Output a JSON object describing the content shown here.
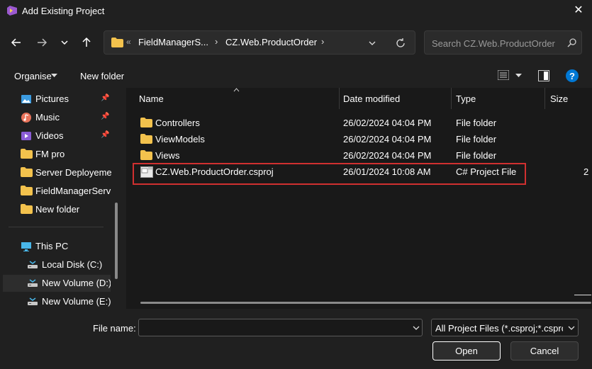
{
  "window": {
    "title": "Add Existing Project"
  },
  "address": {
    "overflow": "«",
    "crumb1": "FieldManagerS...",
    "crumb2": "CZ.Web.ProductOrder"
  },
  "search": {
    "placeholder": "Search CZ.Web.ProductOrder"
  },
  "toolbar": {
    "organise": "Organise",
    "new_folder": "New folder"
  },
  "nav": {
    "quick_access": [
      {
        "label": "Pictures",
        "icon": "pictures-icon",
        "pinned": true
      },
      {
        "label": "Music",
        "icon": "music-icon",
        "pinned": true
      },
      {
        "label": "Videos",
        "icon": "videos-icon",
        "pinned": true
      },
      {
        "label": "FM pro",
        "icon": "folder-icon",
        "pinned": false
      },
      {
        "label": "Server Deployeme",
        "icon": "folder-icon",
        "pinned": false
      },
      {
        "label": "FieldManagerServ",
        "icon": "folder-icon",
        "pinned": false
      },
      {
        "label": "New folder",
        "icon": "folder-icon",
        "pinned": false
      }
    ],
    "this_pc": "This PC",
    "drives": [
      "Local Disk (C:)",
      "New Volume (D:)",
      "New Volume (E:)"
    ]
  },
  "columns": {
    "name": "Name",
    "date": "Date modified",
    "type": "Type",
    "size": "Size"
  },
  "files": [
    {
      "name": "Controllers",
      "date": "26/02/2024 04:04 PM",
      "type": "File folder",
      "size": "",
      "kind": "folder"
    },
    {
      "name": "ViewModels",
      "date": "26/02/2024 04:04 PM",
      "type": "File folder",
      "size": "",
      "kind": "folder"
    },
    {
      "name": "Views",
      "date": "26/02/2024 04:04 PM",
      "type": "File folder",
      "size": "",
      "kind": "folder"
    },
    {
      "name": "CZ.Web.ProductOrder.csproj",
      "date": "26/01/2024 10:08 AM",
      "type": "C# Project File",
      "size": "2",
      "kind": "file"
    }
  ],
  "footer": {
    "filename_label": "File name:",
    "filename_value": "",
    "filter": "All Project Files (*.csproj;*.csproj",
    "open": "Open",
    "cancel": "Cancel"
  },
  "colors": {
    "bg": "#202020",
    "content_bg": "#191919",
    "folder": "#f3c24d",
    "highlight": "#d03030",
    "accent": "#0078d4"
  }
}
